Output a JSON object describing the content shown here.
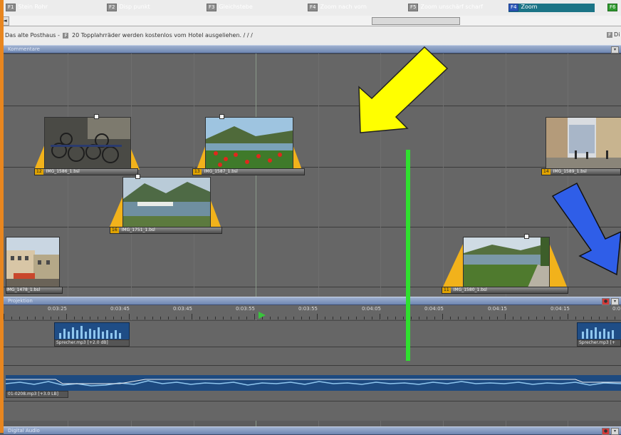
{
  "toolbar": {
    "buttons": [
      {
        "key": "F1",
        "label": "Stein Rohr"
      },
      {
        "key": "F2",
        "label": "Disp punkt"
      },
      {
        "key": "F3",
        "label": "Gleichstebe"
      },
      {
        "key": "F4",
        "label": "Zoom nach vorn"
      },
      {
        "key": "F5",
        "label": "Zoom unschärf scharf"
      },
      {
        "key": "F4",
        "label": "Zoom"
      },
      {
        "key": "F6",
        "label": ""
      }
    ]
  },
  "scrollbar": {
    "left_arrow": "◄"
  },
  "caption_bar": {
    "text_before": "Das alte Posthaus -",
    "tag": "F",
    "text_after": "20 Topplahrräder werden kostenlos vom Hotel ausgeliehen. / /   /",
    "right_tag": "F",
    "right_text": "Di"
  },
  "sections": {
    "top": {
      "label": "Kommentare"
    },
    "projection": {
      "label": "Projektion"
    },
    "bottom": {
      "label": "Digital Audio"
    }
  },
  "photo_clips": [
    {
      "number": "12",
      "name": "IMG_1586_1.bsl"
    },
    {
      "number": "13",
      "name": "IMG_1587_1.bsl"
    },
    {
      "number": "14",
      "name": "IMG_1589_1.bsl"
    },
    {
      "number": "16",
      "name": "IMG_1751_1.bsl"
    },
    {
      "number": "",
      "name": "IMG_1478_1.bsl"
    },
    {
      "number": "11",
      "name": "IMG_1580_1.bsl"
    }
  ],
  "ruler": {
    "ticks": [
      "0:03:25",
      "0:03:45",
      "0:03:45",
      "0:03:55",
      "0:03:55",
      "0:04:05",
      "0:04:05",
      "0:04:15",
      "0:04:15",
      "0:0"
    ]
  },
  "audio_clips": [
    {
      "name": "Sprecher.mp3 [+2.0 dB]"
    },
    {
      "name": "Sprecher.mp3 [+"
    }
  ],
  "music_track": {
    "name": "01-0208.mp3 [+3.0 LB]"
  },
  "colors": {
    "frame": "#e8861f",
    "track": "#666666",
    "green_marker": "#2fe02f",
    "yellow_arrow": "#ffff00",
    "blue_arrow": "#2f5ee8",
    "audio_wave": "#1f4d86"
  }
}
